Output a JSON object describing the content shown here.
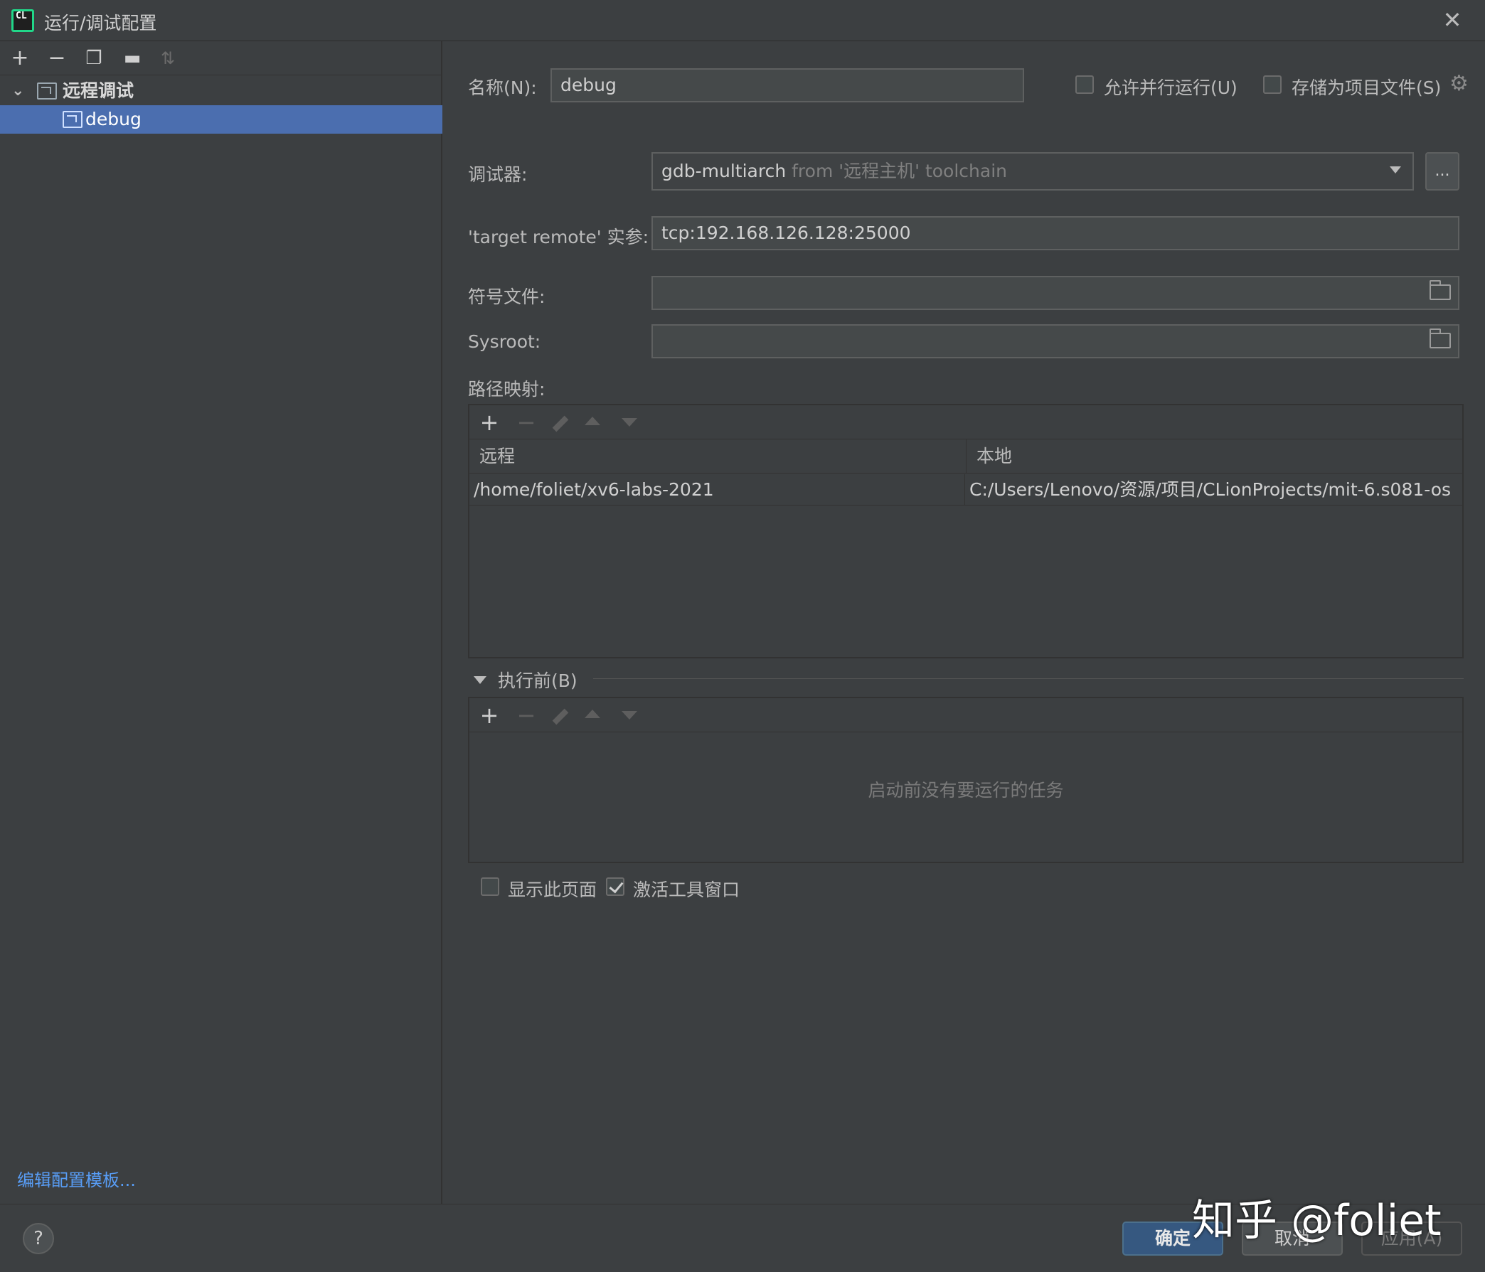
{
  "window": {
    "title": "运行/调试配置"
  },
  "left": {
    "toolbar": {
      "add": "+",
      "remove": "−"
    },
    "tree": {
      "group_label": "远程调试",
      "selected_item": "debug"
    },
    "edit_templates_link": "编辑配置模板..."
  },
  "form": {
    "name_label": "名称(N):",
    "name_value": "debug",
    "allow_parallel_label": "允许并行运行(U)",
    "allow_parallel_checked": false,
    "store_as_project_label": "存储为项目文件(S)",
    "store_as_project_checked": false,
    "debugger_label": "调试器:",
    "debugger_value": "gdb-multiarch",
    "debugger_suffix": "from '远程主机' toolchain",
    "debugger_more": "...",
    "target_remote_label": "'target remote' 实参:",
    "target_remote_value": "tcp:192.168.126.128:25000",
    "symbol_file_label": "符号文件:",
    "symbol_file_value": "",
    "sysroot_label": "Sysroot:",
    "sysroot_value": "",
    "path_mapping_label": "路径映射:"
  },
  "path_mappings": {
    "columns": [
      "远程",
      "本地"
    ],
    "rows": [
      {
        "remote": "/home/foliet/xv6-labs-2021",
        "local": "C:/Users/Lenovo/资源/项目/CLionProjects/mit-6.s081-os"
      }
    ]
  },
  "before_launch": {
    "header": "执行前(B)",
    "empty_text": "启动前没有要运行的任务"
  },
  "options": {
    "show_page_label": "显示此页面",
    "show_page_checked": false,
    "activate_tool_window_label": "激活工具窗口",
    "activate_tool_window_checked": true
  },
  "buttons": {
    "help": "?",
    "ok": "确定",
    "cancel": "取消",
    "apply": "应用(A)"
  },
  "watermark": "知乎 @foliet",
  "colors": {
    "selection": "#4b6eaf",
    "link": "#589df6",
    "primary_button": "#365880",
    "background": "#3c3f41"
  }
}
